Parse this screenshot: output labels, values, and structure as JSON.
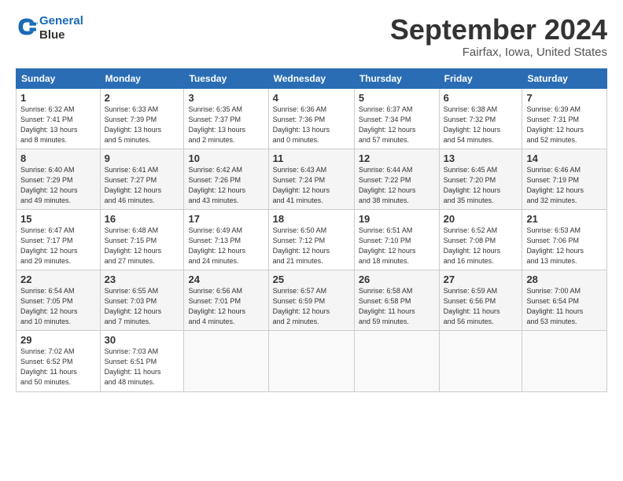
{
  "header": {
    "logo_line1": "General",
    "logo_line2": "Blue",
    "month": "September 2024",
    "location": "Fairfax, Iowa, United States"
  },
  "days_of_week": [
    "Sunday",
    "Monday",
    "Tuesday",
    "Wednesday",
    "Thursday",
    "Friday",
    "Saturday"
  ],
  "weeks": [
    [
      {
        "num": "1",
        "info": "Sunrise: 6:32 AM\nSunset: 7:41 PM\nDaylight: 13 hours\nand 8 minutes."
      },
      {
        "num": "2",
        "info": "Sunrise: 6:33 AM\nSunset: 7:39 PM\nDaylight: 13 hours\nand 5 minutes."
      },
      {
        "num": "3",
        "info": "Sunrise: 6:35 AM\nSunset: 7:37 PM\nDaylight: 13 hours\nand 2 minutes."
      },
      {
        "num": "4",
        "info": "Sunrise: 6:36 AM\nSunset: 7:36 PM\nDaylight: 13 hours\nand 0 minutes."
      },
      {
        "num": "5",
        "info": "Sunrise: 6:37 AM\nSunset: 7:34 PM\nDaylight: 12 hours\nand 57 minutes."
      },
      {
        "num": "6",
        "info": "Sunrise: 6:38 AM\nSunset: 7:32 PM\nDaylight: 12 hours\nand 54 minutes."
      },
      {
        "num": "7",
        "info": "Sunrise: 6:39 AM\nSunset: 7:31 PM\nDaylight: 12 hours\nand 52 minutes."
      }
    ],
    [
      {
        "num": "8",
        "info": "Sunrise: 6:40 AM\nSunset: 7:29 PM\nDaylight: 12 hours\nand 49 minutes."
      },
      {
        "num": "9",
        "info": "Sunrise: 6:41 AM\nSunset: 7:27 PM\nDaylight: 12 hours\nand 46 minutes."
      },
      {
        "num": "10",
        "info": "Sunrise: 6:42 AM\nSunset: 7:26 PM\nDaylight: 12 hours\nand 43 minutes."
      },
      {
        "num": "11",
        "info": "Sunrise: 6:43 AM\nSunset: 7:24 PM\nDaylight: 12 hours\nand 41 minutes."
      },
      {
        "num": "12",
        "info": "Sunrise: 6:44 AM\nSunset: 7:22 PM\nDaylight: 12 hours\nand 38 minutes."
      },
      {
        "num": "13",
        "info": "Sunrise: 6:45 AM\nSunset: 7:20 PM\nDaylight: 12 hours\nand 35 minutes."
      },
      {
        "num": "14",
        "info": "Sunrise: 6:46 AM\nSunset: 7:19 PM\nDaylight: 12 hours\nand 32 minutes."
      }
    ],
    [
      {
        "num": "15",
        "info": "Sunrise: 6:47 AM\nSunset: 7:17 PM\nDaylight: 12 hours\nand 29 minutes."
      },
      {
        "num": "16",
        "info": "Sunrise: 6:48 AM\nSunset: 7:15 PM\nDaylight: 12 hours\nand 27 minutes."
      },
      {
        "num": "17",
        "info": "Sunrise: 6:49 AM\nSunset: 7:13 PM\nDaylight: 12 hours\nand 24 minutes."
      },
      {
        "num": "18",
        "info": "Sunrise: 6:50 AM\nSunset: 7:12 PM\nDaylight: 12 hours\nand 21 minutes."
      },
      {
        "num": "19",
        "info": "Sunrise: 6:51 AM\nSunset: 7:10 PM\nDaylight: 12 hours\nand 18 minutes."
      },
      {
        "num": "20",
        "info": "Sunrise: 6:52 AM\nSunset: 7:08 PM\nDaylight: 12 hours\nand 16 minutes."
      },
      {
        "num": "21",
        "info": "Sunrise: 6:53 AM\nSunset: 7:06 PM\nDaylight: 12 hours\nand 13 minutes."
      }
    ],
    [
      {
        "num": "22",
        "info": "Sunrise: 6:54 AM\nSunset: 7:05 PM\nDaylight: 12 hours\nand 10 minutes."
      },
      {
        "num": "23",
        "info": "Sunrise: 6:55 AM\nSunset: 7:03 PM\nDaylight: 12 hours\nand 7 minutes."
      },
      {
        "num": "24",
        "info": "Sunrise: 6:56 AM\nSunset: 7:01 PM\nDaylight: 12 hours\nand 4 minutes."
      },
      {
        "num": "25",
        "info": "Sunrise: 6:57 AM\nSunset: 6:59 PM\nDaylight: 12 hours\nand 2 minutes."
      },
      {
        "num": "26",
        "info": "Sunrise: 6:58 AM\nSunset: 6:58 PM\nDaylight: 11 hours\nand 59 minutes."
      },
      {
        "num": "27",
        "info": "Sunrise: 6:59 AM\nSunset: 6:56 PM\nDaylight: 11 hours\nand 56 minutes."
      },
      {
        "num": "28",
        "info": "Sunrise: 7:00 AM\nSunset: 6:54 PM\nDaylight: 11 hours\nand 53 minutes."
      }
    ],
    [
      {
        "num": "29",
        "info": "Sunrise: 7:02 AM\nSunset: 6:52 PM\nDaylight: 11 hours\nand 50 minutes."
      },
      {
        "num": "30",
        "info": "Sunrise: 7:03 AM\nSunset: 6:51 PM\nDaylight: 11 hours\nand 48 minutes."
      },
      {
        "num": "",
        "info": ""
      },
      {
        "num": "",
        "info": ""
      },
      {
        "num": "",
        "info": ""
      },
      {
        "num": "",
        "info": ""
      },
      {
        "num": "",
        "info": ""
      }
    ]
  ]
}
